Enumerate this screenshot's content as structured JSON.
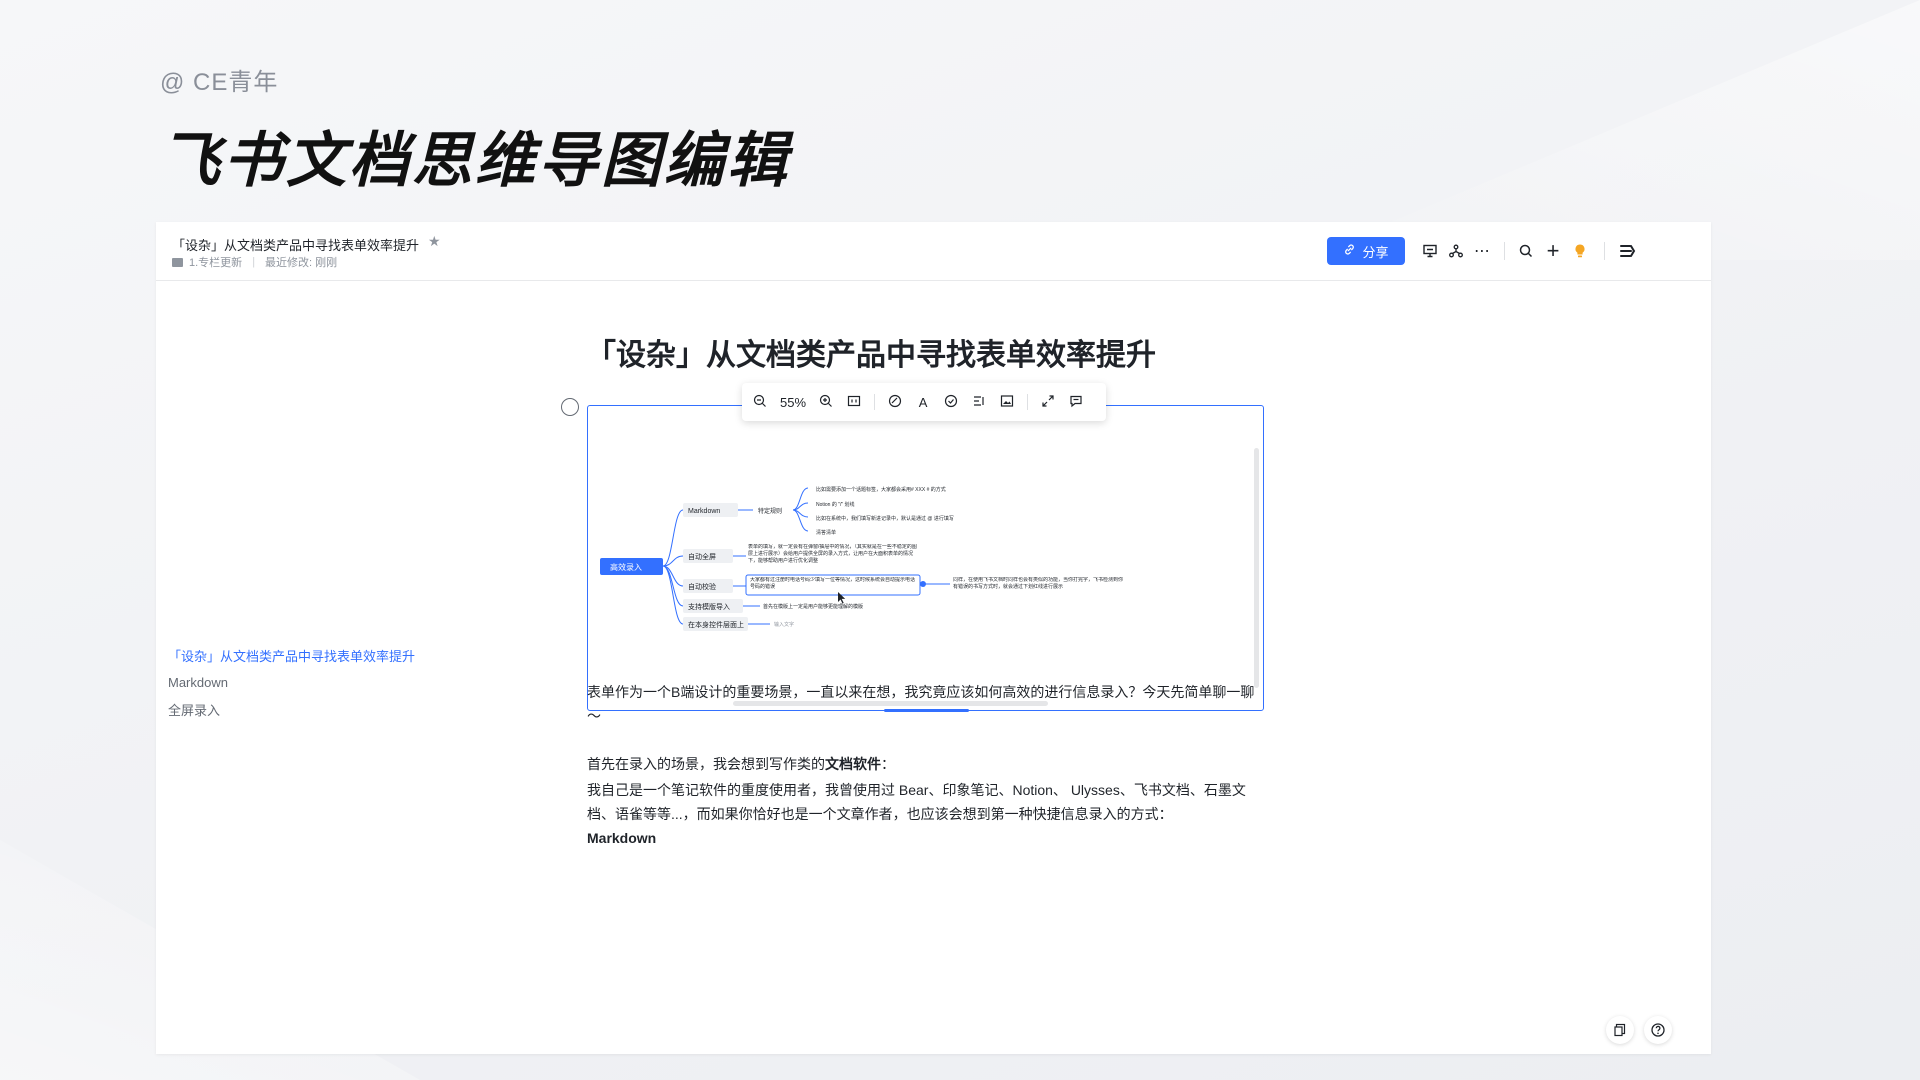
{
  "brand": "@ CE青年",
  "headline": "飞书文档思维导图编辑",
  "topbar": {
    "doc_title": "「设杂」从文档类产品中寻找表单效率提升",
    "star_icon": "star-icon",
    "folder_label": "1.专栏更新",
    "last_modified": "最近修改: 刚刚",
    "share_label": "分享",
    "icons": [
      "presentation-icon",
      "branch-icon",
      "more-icon",
      "search-icon",
      "plus-icon",
      "bulb-icon",
      "app-logo-icon"
    ]
  },
  "outline": {
    "items": [
      "「设杂」从文档类产品中寻找表单效率提升",
      "Markdown",
      "全屏录入"
    ]
  },
  "doc": {
    "title": "「设杂」从文档类产品中寻找表单效率提升",
    "para1": "表单作为一个B端设计的重要场景，一直以来在想，我究竟应该如何高效的进行信息录入？今天先简单聊一聊～",
    "para2_prefix": "首先在录入的场景，我会想到写作类的",
    "para2_bold": "文档软件",
    "para2_suffix": "：",
    "para3": "我自己是一个笔记软件的重度使用者，我曾使用过 Bear、印象笔记、Notion、 Ulysses、飞书文档、石墨文档、语雀等等...，而如果你恰好也是一个文章作者，也应该会想到第一种快捷信息录入的方式：",
    "para3_bold": "Markdown"
  },
  "mindmap_toolbar": {
    "zoom": "55%",
    "icons": [
      "zoom-out-icon",
      "zoom-in-icon",
      "fit-icon",
      "style-icon",
      "text-style-icon",
      "check-icon",
      "list-icon",
      "image-icon",
      "fullscreen-icon",
      "comment-icon"
    ]
  },
  "mindmap": {
    "root": "高效录入",
    "branches": [
      {
        "label": "Markdown",
        "sub": "特定规则",
        "leaves": [
          "比如需要添加一个话题标签，大家都会采用# XXX # 的方式",
          "Notion 的 \"/\" 划线",
          "比如在系统中，我们填写新进记录中，默认是通过 @ 进行填写",
          "清答清单"
        ]
      },
      {
        "label": "自动全屏",
        "leaves": [
          "表单的填写，就一定会有在弹窗/抽屉中的情况，（其实就是在一些不稳定的图层上进行展示）会给用户提供全屏的录入方式，让用户在大面积表单的情况下，能够帮助用户进行优化调整"
        ]
      },
      {
        "label": "自动校验",
        "leaves": [
          "大家都有过注册时电话号码少填写一位等情况，这时候系统会自动提示电话号码的错误"
        ],
        "side": "同样，在使用飞书文档时同样也会有类似的功能，当你打完字，飞书检测到你有错误的书写方式时，就会通过下划红线进行展示"
      },
      {
        "label": "支持模版导入",
        "leaves": [
          "首先在模版上一定是用户能够更能理解的模版"
        ]
      },
      {
        "label": "在本身控件层面上",
        "leaves": [
          "输入文字"
        ]
      }
    ]
  },
  "fab_icons": [
    "copy-icon",
    "help-icon"
  ]
}
